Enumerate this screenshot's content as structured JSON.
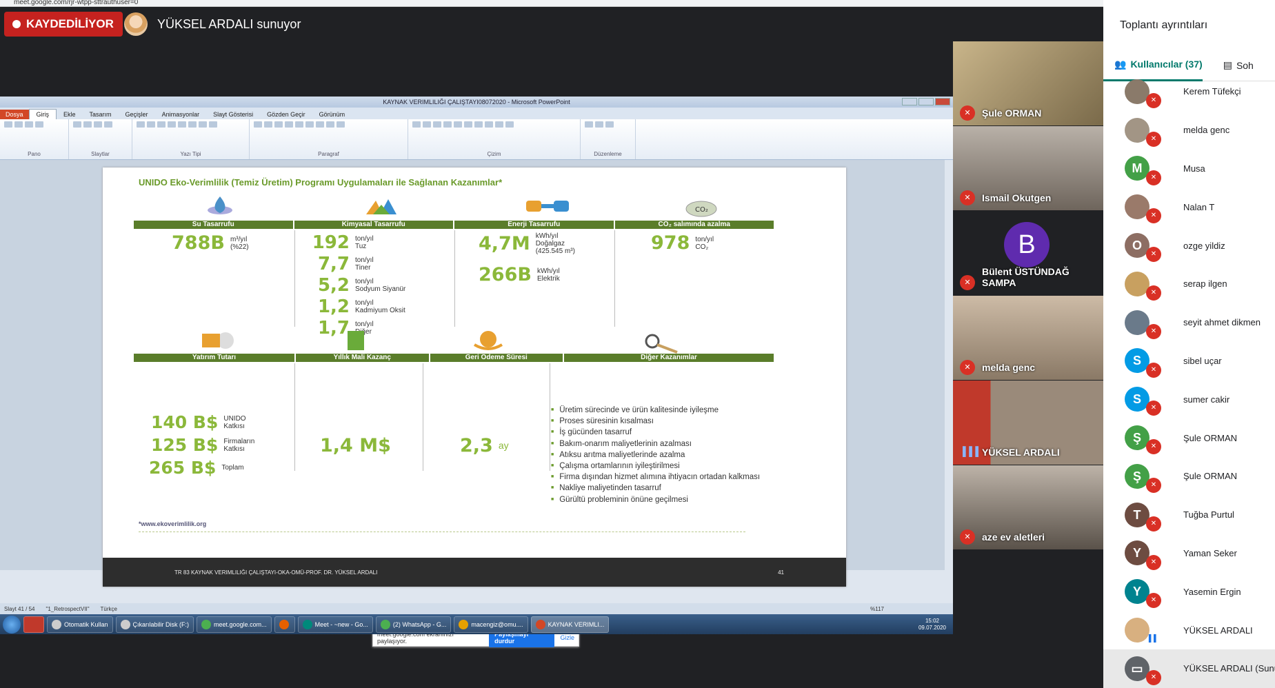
{
  "browser": {
    "url": "meet.google.com/rjr-wtpp-sttrauthuser=0"
  },
  "meeting": {
    "recording_label": "KAYDEDİLİYOR",
    "presenter_text": "YÜKSEL ARDALI sunuyor"
  },
  "ppt": {
    "window_title": "KAYNAK VERIMLILIĞI ÇALIŞTAYI08072020 - Microsoft PowerPoint",
    "tabs": [
      "Dosya",
      "Giriş",
      "Ekle",
      "Tasarım",
      "Geçişler",
      "Animasyonlar",
      "Slayt Gösterisi",
      "Gözden Geçir",
      "Görünüm"
    ],
    "groups": [
      "Pano",
      "Slaytlar",
      "Yazı Tipi",
      "Paragraf",
      "Çizim",
      "Düzenleme"
    ],
    "status_slide": "Slayt 41 / 54",
    "status_theme": "\"1_RetrospectVII\"",
    "status_lang": "Türkçe",
    "zoom": "%117"
  },
  "slide": {
    "title": "UNIDO Eko-Verimlilik (Temiz Üretim) Programı Uygulamaları ile Sağlanan Kazanımlar*",
    "top_headers": [
      "Su Tasarrufu",
      "Kimyasal Tasarrufu",
      "Enerji Tasarrufu",
      "CO₂ salımında azalma"
    ],
    "water": {
      "value": "788B",
      "unit": "m³/yıl\n(%22)"
    },
    "chemicals": [
      {
        "value": "192",
        "unit": "ton/yıl\nTuz"
      },
      {
        "value": "7,7",
        "unit": "ton/yıl\nTiner"
      },
      {
        "value": "5,2",
        "unit": "ton/yıl\nSodyum Siyanür"
      },
      {
        "value": "1,2",
        "unit": "ton/yıl\nKadmiyum Oksit"
      },
      {
        "value": "1,7",
        "unit": "ton/yıl\nDiğer"
      }
    ],
    "energy": [
      {
        "value": "4,7M",
        "unit": "kWh/yıl\nDoğalgaz\n(425.545 m³)"
      },
      {
        "value": "266B",
        "unit": "kWh/yıl\nElektrik"
      }
    ],
    "co2": {
      "value": "978",
      "unit": "ton/yıl\nCO₂"
    },
    "bottom_headers": [
      "Yatırım Tutarı",
      "Yıllık Mali Kazanç",
      "Geri Ödeme Süresi",
      "Diğer Kazanımlar"
    ],
    "investment": [
      {
        "value": "140 B$",
        "unit": "UNIDO\nKatkısı"
      },
      {
        "value": "125 B$",
        "unit": "Firmaların\nKatkısı"
      },
      {
        "value": "265 B$",
        "unit": "Toplam"
      }
    ],
    "annual_gain": "1,4 M$",
    "payback": {
      "value": "2,3",
      "unit": "ay"
    },
    "benefits": [
      "Üretim sürecinde ve ürün kalitesinde iyileşme",
      "Proses süresinin kısalması",
      "İş gücünden tasarruf",
      "Bakım-onarım maliyetlerinin azalması",
      "Atıksu arıtma maliyetlerinde azalma",
      "Çalışma ortamlarının iyileştirilmesi",
      "Firma dışından hizmet alımına ihtiyacın ortadan kalkması",
      "Nakliye maliyetinden tasarruf",
      "Gürültü probleminin önüne geçilmesi"
    ],
    "website": "*www.ekoverimlilik.org",
    "footer": "TR 83 KAYNAK VERIMLILIĞI ÇALIŞTAYI-OKA-OMÜ-PROF. DR. YÜKSEL ARDALI",
    "page_number": "41"
  },
  "share_bar": {
    "text": "meet.google.com ekranınızı paylaşıyor.",
    "stop": "Paylaşmayı durdur",
    "hide": "Gizle"
  },
  "taskbar": {
    "items": [
      "Otomatik Kullan",
      "Çıkarılabilir Disk (F:)",
      "meet.google.com...",
      "Meet - ~new - Go...",
      "(2) WhatsApp - G...",
      "macengiz@omu....",
      "KAYNAK VERIMLI..."
    ],
    "time": "15:02",
    "date": "09.07.2020"
  },
  "tiles": [
    {
      "name": "Şule ORMAN",
      "color": "#b89a6a"
    },
    {
      "name": "Ismail Okutgen",
      "color": "#9a8f86"
    },
    {
      "name": "Bülent ÜSTÜNDAĞ SAMPA",
      "color": "#202124",
      "initial": "B"
    },
    {
      "name": "melda genc",
      "color": "#a89480"
    },
    {
      "name": "YÜKSEL ARDALI",
      "color": "#b2473e"
    },
    {
      "name": "aze ev aletleri",
      "color": "#8a8078"
    }
  ],
  "panel": {
    "title": "Toplantı ayrıntıları",
    "tab_people": "Kullanıcılar (37)",
    "tab_chat": "Soh",
    "participants": [
      {
        "name": "Kerem Tüfekçi",
        "initial": "",
        "color": "#8a7a6a"
      },
      {
        "name": "melda genc",
        "initial": "",
        "color": "#a29585"
      },
      {
        "name": "Musa",
        "initial": "M",
        "color": "#43a047"
      },
      {
        "name": "Nalan T",
        "initial": "",
        "color": "#9a7a6a"
      },
      {
        "name": "ozge yildiz",
        "initial": "O",
        "color": "#8d6e63"
      },
      {
        "name": "serap ilgen",
        "initial": "",
        "color": "#c8a060"
      },
      {
        "name": "seyit ahmet dikmen",
        "initial": "",
        "color": "#6a7a8a"
      },
      {
        "name": "sibel uçar",
        "initial": "S",
        "color": "#039be5"
      },
      {
        "name": "sumer cakir",
        "initial": "S",
        "color": "#039be5"
      },
      {
        "name": "Şule ORMAN",
        "initial": "Ş",
        "color": "#43a047"
      },
      {
        "name": "Şule ORMAN",
        "initial": "Ş",
        "color": "#43a047"
      },
      {
        "name": "Tuğba Purtul",
        "initial": "T",
        "color": "#6d4c41"
      },
      {
        "name": "Yaman Seker",
        "initial": "Y",
        "color": "#6d4c41"
      },
      {
        "name": "Yasemin Ergin",
        "initial": "Y",
        "color": "#00838f"
      },
      {
        "name": "YÜKSEL ARDALI",
        "initial": "",
        "color": "#d8b080"
      },
      {
        "name": "YÜKSEL ARDALI (Sunu)",
        "initial": "",
        "color": "#5f6368"
      }
    ]
  }
}
